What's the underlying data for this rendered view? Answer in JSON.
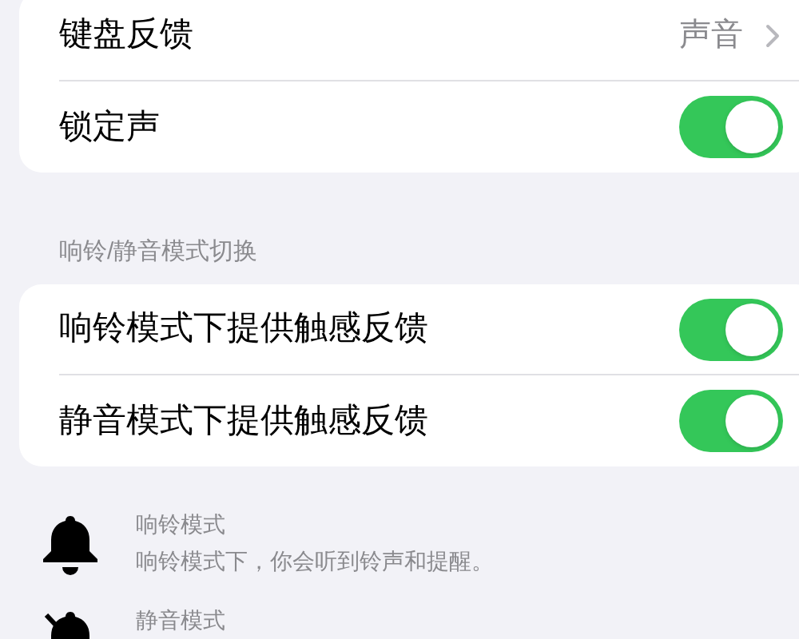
{
  "sections": [
    {
      "rows": [
        {
          "kind": "link",
          "label": "键盘反馈",
          "value": "声音"
        },
        {
          "kind": "toggle",
          "label": "锁定声",
          "on": true
        }
      ]
    },
    {
      "header": "响铃/静音模式切换",
      "rows": [
        {
          "kind": "toggle",
          "label": "响铃模式下提供触感反馈",
          "on": true
        },
        {
          "kind": "toggle",
          "label": "静音模式下提供触感反馈",
          "on": true
        }
      ]
    }
  ],
  "modes": [
    {
      "kind": "bell",
      "title": "响铃模式",
      "description": "响铃模式下，你会听到铃声和提醒。"
    },
    {
      "kind": "bell-slash",
      "title": "静音模式"
    }
  ]
}
